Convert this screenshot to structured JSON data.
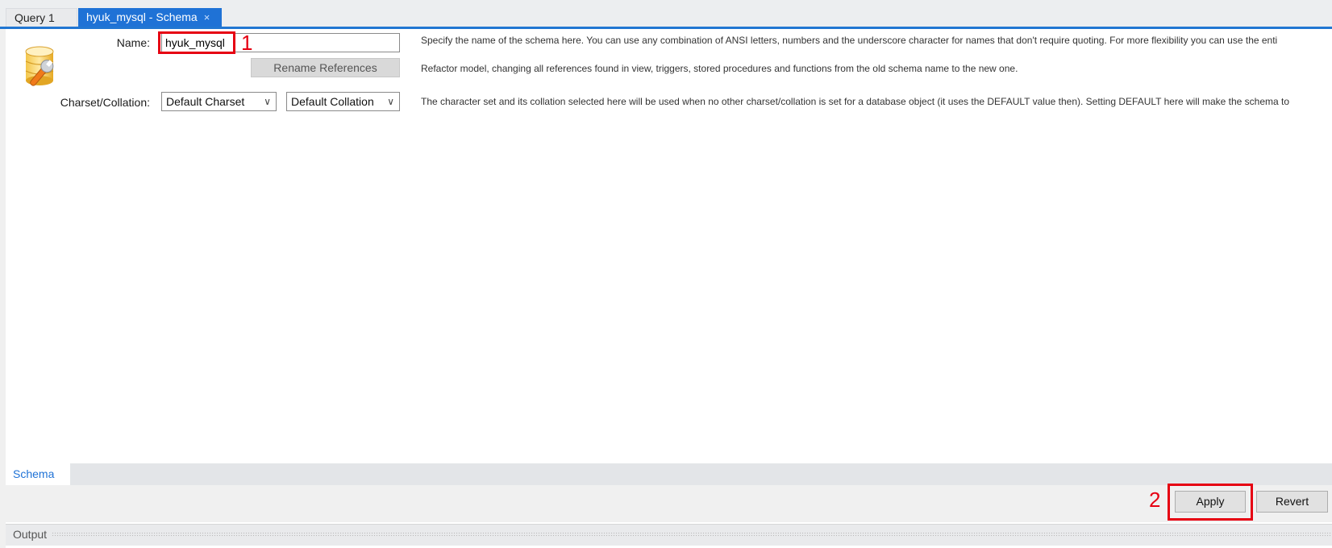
{
  "tabs": [
    {
      "label": "Query 1",
      "active": false
    },
    {
      "label": "hyuk_mysql - Schema",
      "active": true
    }
  ],
  "tab_close_glyph": "×",
  "form": {
    "name_label": "Name:",
    "name_value": "hyuk_mysql",
    "rename_button": "Rename References",
    "charset_label": "Charset/Collation:",
    "charset_value": "Default Charset",
    "collation_value": "Default Collation"
  },
  "descriptions": {
    "name": "Specify the name of the schema here. You can use any combination of ANSI letters, numbers and the underscore character for names that don't require quoting. For more flexibility you can use the enti",
    "rename": "Refactor model, changing all references found in view, triggers, stored procedures and functions from the old schema name to the new one.",
    "charset": "The character set and its collation selected here will be used when no other charset/collation is set for a database object (it uses the DEFAULT value then). Setting DEFAULT here will make the schema to"
  },
  "bottom": {
    "subtab": "Schema",
    "apply_button": "Apply",
    "revert_button": "Revert"
  },
  "annotations": {
    "marker_1": "1",
    "marker_2": "2"
  },
  "output": {
    "label": "Output"
  },
  "colors": {
    "accent": "#1f72d6",
    "annotation_red": "#e60012"
  },
  "icons": {
    "schema": "database-wrench-icon",
    "dropdown": "chevron-down-icon",
    "close": "close-icon"
  }
}
